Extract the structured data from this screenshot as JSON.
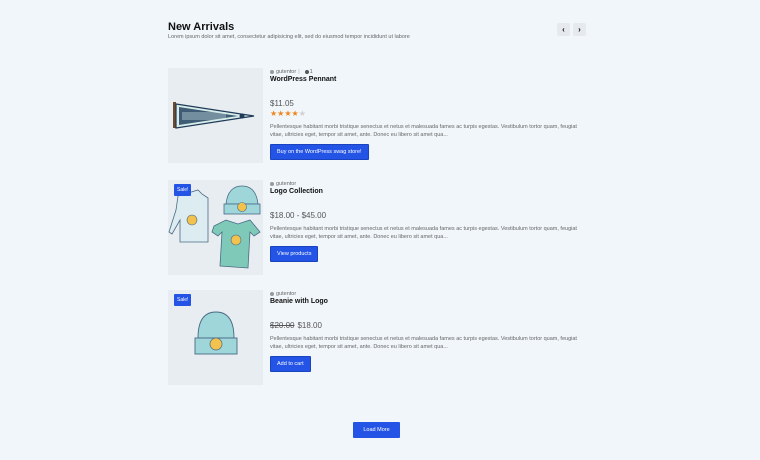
{
  "header": {
    "title": "New Arrivals",
    "subtitle": "Lorem ipsum dolor sit amet, consectetur adipisicing elit, sed do eiusmod tempor incididunt ut labore",
    "prev_icon": "‹",
    "next_icon": "›"
  },
  "products": [
    {
      "author": "gutentor",
      "separator": "|",
      "comments": "1",
      "title": "WordPress Pennant",
      "price": "$11.05",
      "rating": 4,
      "rating_max": 5,
      "description": "Pellentesque habitant morbi tristique senectus et netus et malesuada fames ac turpis egestas. Vestibulum tortor quam, feugiat vitae, ultricies eget, tempor sit amet, ante. Donec eu libero sit amet qua...",
      "button": "Buy on the WordPress swag store!"
    },
    {
      "badge": "Sale!",
      "author": "gutentor",
      "title": "Logo Collection",
      "price": "$18.00 - $45.00",
      "description": "Pellentesque habitant morbi tristique senectus et netus et malesuada fames ac turpis egestas. Vestibulum tortor quam, feugiat vitae, ultricies eget, tempor sit amet, ante. Donec eu libero sit amet qua...",
      "button": "View products"
    },
    {
      "badge": "Sale!",
      "author": "gutentor",
      "title": "Beanie with Logo",
      "price_old": "$20.00",
      "price": "$18.00",
      "description": "Pellentesque habitant morbi tristique senectus et netus et malesuada fames ac turpis egestas. Vestibulum tortor quam, feugiat vitae, ultricies eget, tempor sit amet, ante. Donec eu libero sit amet qua...",
      "button": "Add to cart"
    }
  ],
  "load_more": "Load More",
  "colors": {
    "accent": "#2354e6",
    "stars": "#f0841b",
    "background": "#f1f6fa"
  }
}
